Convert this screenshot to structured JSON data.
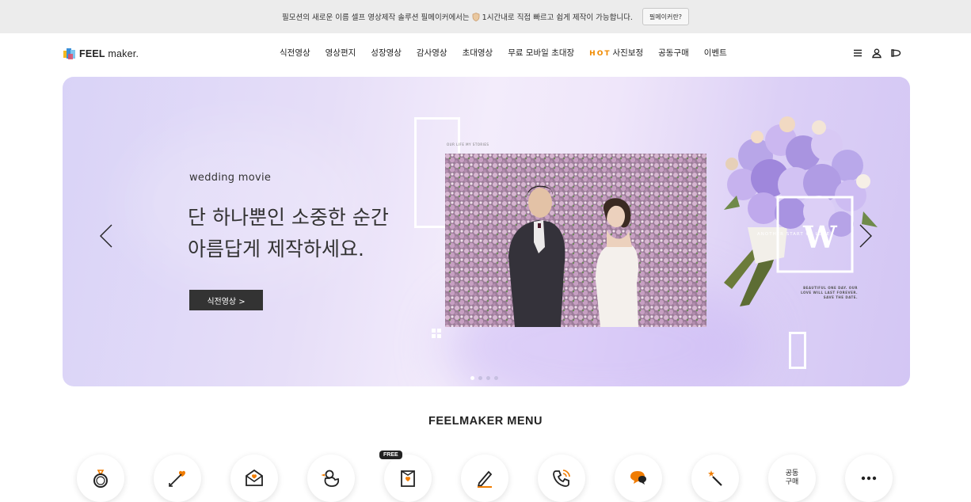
{
  "topbar": {
    "message_a": "필모션의 새로운 이름 셀프 영상제작 솔루션 필메이커에서는",
    "message_b": "1시간내로 직접 빠르고 쉽게 제작이 가능합니다.",
    "button": "필메이커란?"
  },
  "header": {
    "logo_bold": "FEEL",
    "logo_light": " maker.",
    "nav": [
      "식전영상",
      "영상편지",
      "성장영상",
      "감사영상",
      "초대영상",
      "무료 모바일 초대장",
      "사진보정",
      "공동구매",
      "이벤트"
    ],
    "hot_label": "HOT",
    "icons": [
      "menu-icon",
      "user-icon",
      "cart-icon"
    ]
  },
  "hero": {
    "subtitle": "wedding movie",
    "title_line1": "단 하나뿐인 소중한 순간",
    "title_line2": "아름답게 제작하세요.",
    "cta": "식전영상 >",
    "slide_count": 4,
    "active_slide": 1,
    "photo_caption": "OUR LIFE MY STORIES",
    "bouquet_text": "ANOTHER START OF LOVE",
    "bouquet_letter": "W",
    "tagline": "BEAUTIFUL ONE DAY. OUR LOVE WILL LAST FOREVER. SAVE THE DATE."
  },
  "menu": {
    "title": "FEELMAKER MENU",
    "free_badge": "FREE",
    "group_buy_label": "공동\n구매",
    "items": [
      "ring-icon",
      "cupid-arrow-icon",
      "letter-icon",
      "duck-icon",
      "mobile-invitation-icon",
      "pen-icon",
      "phone-call-icon",
      "chat-icon",
      "magic-wand-icon",
      "group-buy-text",
      "more-icon"
    ]
  },
  "colors": {
    "hot": "#f08a00",
    "accent_orange": "#f07c00",
    "hero_bg": "#dcd2f6",
    "cta_bg": "#333333"
  }
}
